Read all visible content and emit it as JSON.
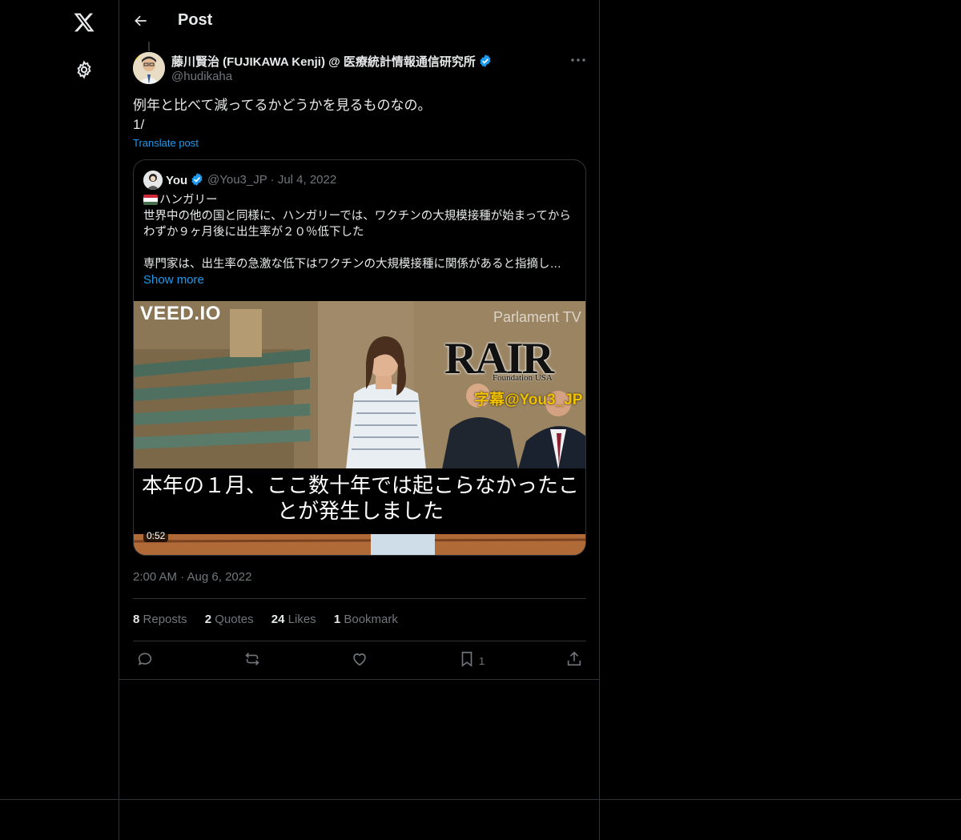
{
  "page": {
    "title": "Post"
  },
  "author": {
    "name": "藤川賢治 (FUJIKAWA Kenji) @ 医療統計情報通信研究所",
    "handle": "@hudikaha"
  },
  "tweet": {
    "text": "例年と比べて減ってるかどうかを見るものなの。\n1/",
    "translate_label": "Translate post",
    "timestamp": "2:00 AM · Aug 6, 2022"
  },
  "quote": {
    "name": "You",
    "handle": "@You3_JP",
    "date": "Jul 4, 2022",
    "line1": "ハンガリー",
    "line2": "世界中の他の国と同様に、ハンガリーでは、ワクチンの大規模接種が始まってからわずか９ヶ月後に出生率が２０％低下した",
    "line3": "専門家は、出生率の急激な低下はワクチンの大規模接種に関係があると指摘し…",
    "show_more": "Show more",
    "video": {
      "watermark": "VEED.IO",
      "channel": "Parlament TV",
      "logo_text": "RAIR",
      "logo_sub": "Foundation USA",
      "subtitle_credit": "字幕@You3_JP",
      "caption": "本年の１月、ここ数十年では起こらなかったことが発生しました",
      "duration": "0:52"
    }
  },
  "stats": [
    {
      "count": "8",
      "label": "Reposts"
    },
    {
      "count": "2",
      "label": "Quotes"
    },
    {
      "count": "24",
      "label": "Likes"
    },
    {
      "count": "1",
      "label": "Bookmark"
    }
  ],
  "actions": {
    "bookmark_count": "1"
  },
  "colors": {
    "accent": "#1d9bf0",
    "background": "#000000",
    "muted": "#71767b",
    "border": "#2f3336"
  }
}
